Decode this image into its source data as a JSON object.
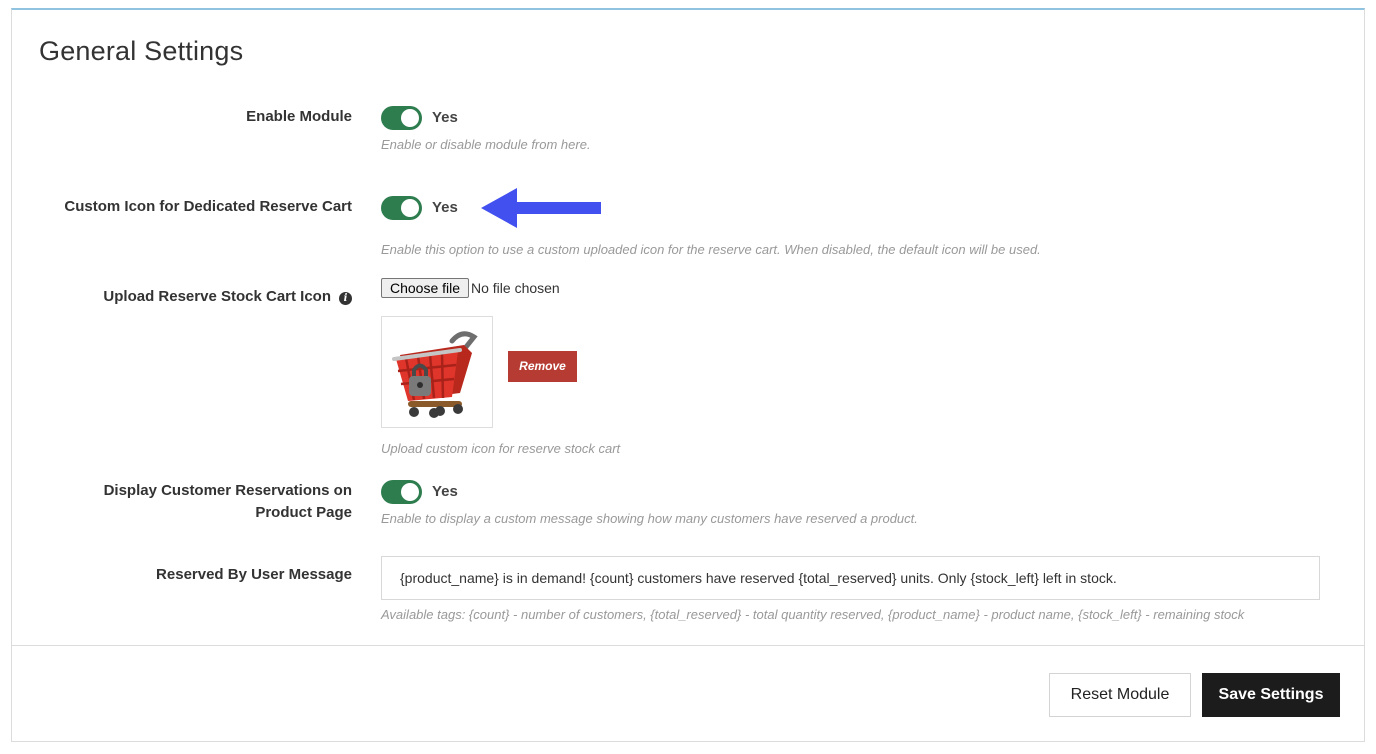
{
  "panel": {
    "title": "General Settings"
  },
  "settings": {
    "enable_module": {
      "label": "Enable Module",
      "value": "Yes",
      "help": "Enable or disable module from here."
    },
    "custom_icon": {
      "label": "Custom Icon for Dedicated Reserve Cart",
      "value": "Yes",
      "help": "Enable this option to use a custom uploaded icon for the reserve cart. When disabled, the default icon will be used."
    },
    "upload_icon": {
      "label": "Upload Reserve Stock Cart Icon",
      "choose_file_label": "Choose file",
      "file_status": "No file chosen",
      "remove_label": "Remove",
      "help": "Upload custom icon for reserve stock cart"
    },
    "display_reservations": {
      "label": "Display Customer Reservations on Product Page",
      "value": "Yes",
      "help": "Enable to display a custom message showing how many customers have reserved a product."
    },
    "reserved_message": {
      "label": "Reserved By User Message",
      "value": "{product_name} is in demand! {count} customers have reserved {total_reserved} units. Only {stock_left} left in stock.",
      "help": "Available tags: {count} - number of customers, {total_reserved} - total quantity reserved, {product_name} - product name, {stock_left} - remaining stock"
    }
  },
  "footer": {
    "reset_label": "Reset Module",
    "save_label": "Save Settings"
  },
  "colors": {
    "toggle_on": "#2e7d4f",
    "remove_button": "#b63c33",
    "save_button": "#1c1c1c",
    "annotation_arrow": "#4250f0",
    "panel_top_border": "#8fc3e0"
  },
  "icons": {
    "info": "info-circle-icon",
    "arrow": "left-arrow-annotation",
    "thumbnail": "shopping-cart-with-lock-image"
  }
}
